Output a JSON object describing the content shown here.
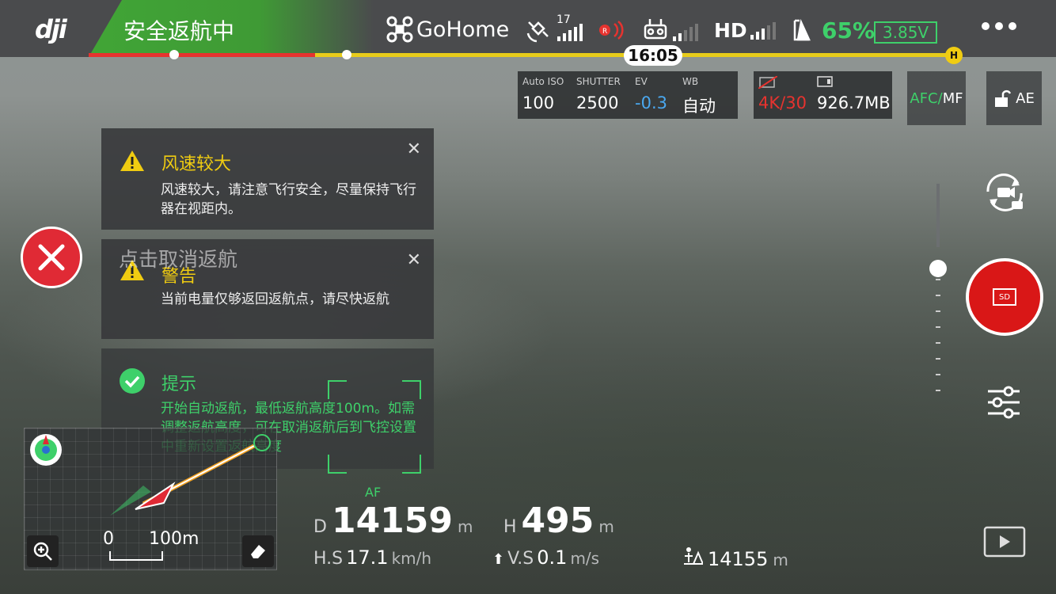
{
  "topbar": {
    "brand": "dji",
    "mode": "安全返航中",
    "flight_mode": "GoHome",
    "satellites": "17",
    "video_link": "HD",
    "battery_percent": "65%",
    "battery_voltage": "3.85V",
    "time": "16:05",
    "home_marker": "H"
  },
  "camera": {
    "iso_label": "Auto ISO",
    "iso_value": "100",
    "shutter_label": "SHUTTER",
    "shutter_value": "2500",
    "ev_label": "EV",
    "ev_value": "-0.3",
    "wb_label": "WB",
    "wb_value": "自动",
    "resolution": "4K/30",
    "storage": "926.7MB",
    "focus_mode_a": "AFC/",
    "focus_mode_b": "MF",
    "ae": "AE",
    "af_label": "AF"
  },
  "notifications": [
    {
      "title": "风速较大",
      "body": "风速较大，请注意飞行安全，尽量保持飞行器在视距内。",
      "type": "warning"
    },
    {
      "title": "警告",
      "body": "当前电量仅够返回返航点，请尽快返航",
      "type": "warning"
    },
    {
      "title": "提示",
      "body": "开始自动返航，最低返航高度100m。如需调整返航高度，可在取消返航后到飞控设置中重新设置返航高度",
      "type": "info"
    }
  ],
  "cancel_rth": {
    "label": "点击取消返航"
  },
  "map": {
    "scale_start": "0",
    "scale_end": "100m"
  },
  "telemetry": {
    "d_label": "D",
    "d_value": "14159",
    "d_unit": "m",
    "h_label": "H",
    "h_value": "495",
    "h_unit": "m",
    "hs_label": "H.S",
    "hs_value": "17.1",
    "hs_unit": "km/h",
    "vs_label": "V.S",
    "vs_value": "0.1",
    "vs_unit": "m/s",
    "home_dist_value": "14155",
    "home_dist_unit": "m"
  },
  "colors": {
    "accent_green": "#3ed06a",
    "mode_green": "#41a536",
    "warning_yellow": "#f0cc11",
    "danger_red": "#e02a35",
    "ev_blue": "#4aa8f0"
  }
}
